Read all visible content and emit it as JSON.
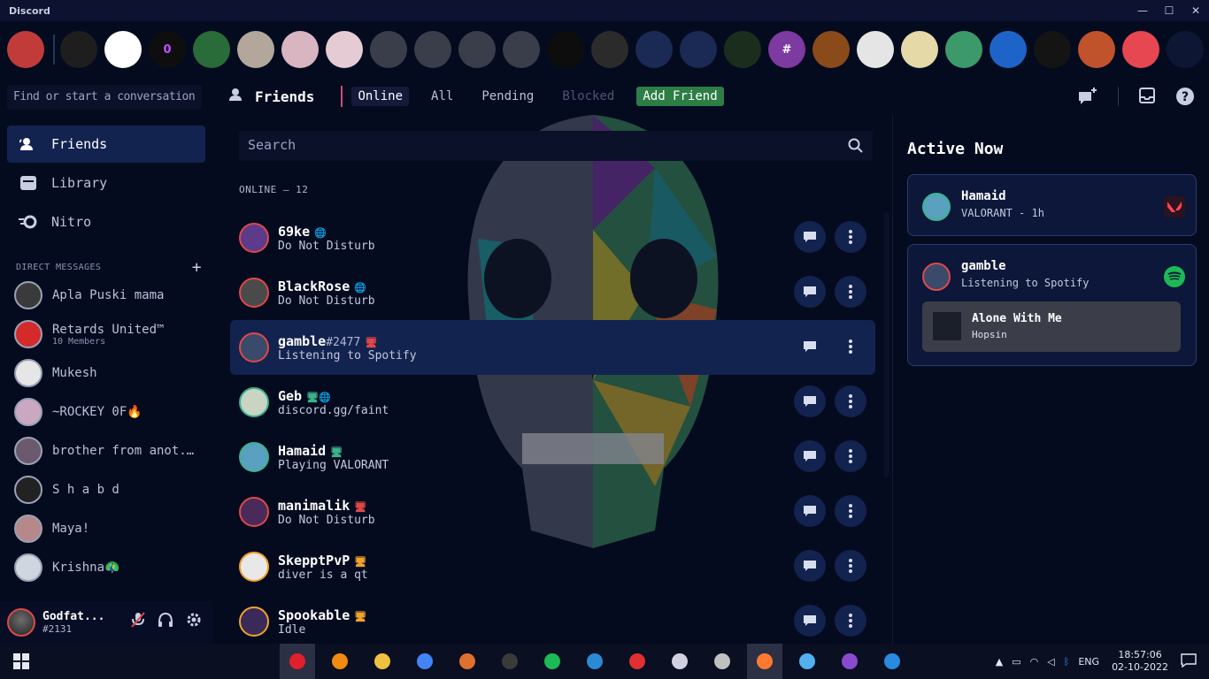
{
  "window": {
    "title": "Discord"
  },
  "servers": [
    {
      "name": "server-1",
      "color": "#c23b3b",
      "glyph": ""
    },
    {
      "name": "server-2",
      "color": "#1e1e1e",
      "glyph": ""
    },
    {
      "name": "server-3",
      "color": "#ffffff",
      "glyph": ""
    },
    {
      "name": "server-4",
      "color": "#0e0e0e",
      "glyph": "0"
    },
    {
      "name": "server-5",
      "color": "#2a6b3a",
      "glyph": ""
    },
    {
      "name": "server-6",
      "color": "#b2a79a",
      "glyph": ""
    },
    {
      "name": "server-7",
      "color": "#d9b5c1",
      "glyph": ""
    },
    {
      "name": "server-8",
      "color": "#e4cbd4",
      "glyph": ""
    },
    {
      "name": "server-9",
      "color": "#3a3d4a",
      "glyph": ""
    },
    {
      "name": "server-10",
      "color": "#3a3d4a",
      "glyph": ""
    },
    {
      "name": "server-11",
      "color": "#3a3d4a",
      "glyph": ""
    },
    {
      "name": "server-12",
      "color": "#3a3d4a",
      "glyph": ""
    },
    {
      "name": "server-13",
      "color": "#0d0d0d",
      "glyph": ""
    },
    {
      "name": "server-14",
      "color": "#2b2b2b",
      "glyph": ""
    },
    {
      "name": "server-15",
      "color": "#1a2a55",
      "glyph": ""
    },
    {
      "name": "server-16",
      "color": "#1a2a55",
      "glyph": ""
    },
    {
      "name": "server-17",
      "color": "#1b2e1d",
      "glyph": ""
    },
    {
      "name": "server-18",
      "color": "#7d3aa0",
      "glyph": "#"
    },
    {
      "name": "server-19",
      "color": "#8a4a1a",
      "glyph": ""
    },
    {
      "name": "server-20",
      "color": "#e5e5e5",
      "glyph": ""
    },
    {
      "name": "server-21",
      "color": "#e6d9a8",
      "glyph": ""
    },
    {
      "name": "server-22",
      "color": "#3c9a6a",
      "glyph": ""
    },
    {
      "name": "server-23",
      "color": "#1e64c8",
      "glyph": ""
    },
    {
      "name": "server-24",
      "color": "#141414",
      "glyph": ""
    },
    {
      "name": "server-25",
      "color": "#c0522c",
      "glyph": ""
    },
    {
      "name": "server-26",
      "color": "#e64750",
      "glyph": ""
    },
    {
      "name": "server-27",
      "color": "#0d1733",
      "glyph": ""
    },
    {
      "name": "server-28",
      "color": "#3a5877",
      "glyph": ""
    }
  ],
  "sidebar": {
    "search_placeholder": "Find or start a conversation",
    "nav": [
      {
        "label": "Friends",
        "icon": "friends-icon",
        "active": true
      },
      {
        "label": "Library",
        "icon": "library-icon",
        "active": false
      },
      {
        "label": "Nitro",
        "icon": "nitro-icon",
        "active": false
      }
    ],
    "dm_header": "DIRECT MESSAGES",
    "dms": [
      {
        "name": "Apla Puski mama",
        "sub": "",
        "color": "#3a3a3a"
      },
      {
        "name": "Retards United™",
        "sub": "10 Members",
        "color": "#d42a2a"
      },
      {
        "name": "Mukesh",
        "sub": "",
        "color": "#e6e6e6"
      },
      {
        "name": "~ROCKEY 0F🔥",
        "sub": "",
        "color": "#caa8c2"
      },
      {
        "name": "brother from anot...",
        "sub": "",
        "color": "#6b5a6e"
      },
      {
        "name": "S h a b d",
        "sub": "",
        "color": "#222222"
      },
      {
        "name": "Maya!",
        "sub": "",
        "color": "#b5898a"
      },
      {
        "name": "Krishna🦚",
        "sub": "",
        "color": "#d0d6e0"
      }
    ]
  },
  "user": {
    "name": "Godfat...",
    "tag": "#2131"
  },
  "header": {
    "title": "Friends",
    "tabs": [
      {
        "label": "Online",
        "state": "active"
      },
      {
        "label": "All",
        "state": "normal"
      },
      {
        "label": "Pending",
        "state": "normal"
      },
      {
        "label": "Blocked",
        "state": "muted"
      },
      {
        "label": "Add Friend",
        "state": "add"
      }
    ]
  },
  "main": {
    "search_placeholder": "Search",
    "online_count": "ONLINE — 12",
    "friends": [
      {
        "name": "69ke",
        "tag": "",
        "status": "Do Not Disturb",
        "badge": "🌐",
        "ring": "#e04848",
        "color": "#5d3a8a"
      },
      {
        "name": "BlackRose",
        "tag": "",
        "status": "Do Not Disturb",
        "badge": "🌐",
        "ring": "#e04848",
        "color": "#4a4a4a"
      },
      {
        "name": "gamble",
        "tag": "#2477",
        "status": "Listening to Spotify",
        "badge": "🖥",
        "ring": "#e04848",
        "color": "#3a4a6a"
      },
      {
        "name": "Geb",
        "tag": "",
        "status": "discord.gg/faint",
        "badge": "🖥🌐",
        "ring": "#3bb38a",
        "color": "#c9d4c2"
      },
      {
        "name": "Hamaid",
        "tag": "",
        "status": "Playing VALORANT",
        "badge": "🖥",
        "ring": "#3bb38a",
        "color": "#5aa0c0"
      },
      {
        "name": "manimalik",
        "tag": "",
        "status": "Do Not Disturb",
        "badge": "🖥",
        "ring": "#e04848",
        "color": "#4a2a5a"
      },
      {
        "name": "SkepptPvP",
        "tag": "",
        "status": "diver is a qt",
        "badge": "🖥",
        "ring": "#f0a22e",
        "color": "#e8e8e8"
      },
      {
        "name": "Spookable",
        "tag": "",
        "status": "Idle",
        "badge": "🖥",
        "ring": "#f0a22e",
        "color": "#3a2a5a"
      }
    ]
  },
  "active_now": {
    "title": "Active Now",
    "cards": [
      {
        "name": "Hamaid",
        "status": "VALORANT - 1h",
        "icon": "valorant-icon",
        "icon_color": "#ff4655"
      },
      {
        "name": "gamble",
        "status": "Listening to Spotify",
        "icon": "spotify-icon",
        "icon_color": "#1db954",
        "song": {
          "title": "Alone With Me",
          "artist": "Hopsin"
        }
      }
    ]
  },
  "taskbar": {
    "apps": [
      "opera-icon",
      "search-icon",
      "file-explorer-icon",
      "chrome-icon",
      "app-icon",
      "terminal-icon",
      "spotify-icon",
      "edge-icon",
      "anydesk-icon",
      "paint-icon",
      "usb-icon",
      "discord-icon",
      "drop-icon",
      "github-icon",
      "vscode-icon"
    ],
    "time": "18:57:06",
    "date": "02-10-2022",
    "lang": "ENG"
  }
}
